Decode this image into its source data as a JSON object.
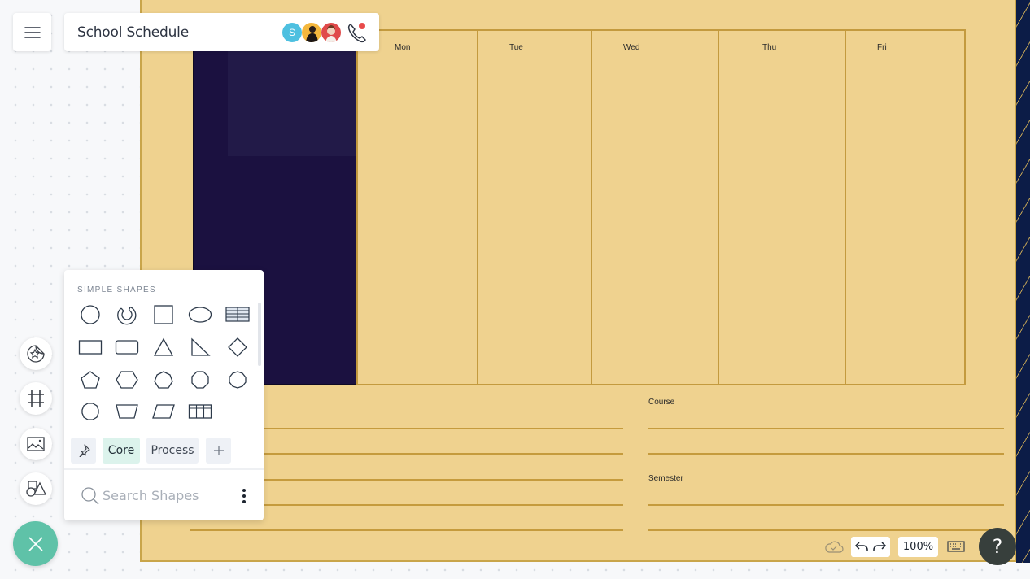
{
  "header": {
    "menu_icon": "hamburger-menu-icon",
    "title": "School Schedule",
    "collaborators": [
      {
        "initial": "S",
        "color": "#4ec0e0"
      },
      {
        "initial": "",
        "color": "#f4b73c"
      },
      {
        "initial": "",
        "color": "#e04a4a"
      }
    ],
    "call_icon": "phone-icon",
    "call_indicator_color": "#e84a4a"
  },
  "canvas": {
    "days": [
      "Mon",
      "Tue",
      "Wed",
      "Thu",
      "Fri"
    ],
    "fields": {
      "course_label": "Course",
      "semester_label": "Semester"
    },
    "colors": {
      "paper": "#efd28f",
      "line": "#c59b3d",
      "navy": "#1b1140",
      "stripe": "#0c1c47"
    }
  },
  "left_rail": {
    "buttons": [
      {
        "name": "sticker-icon"
      },
      {
        "name": "frame-icon"
      },
      {
        "name": "image-icon"
      },
      {
        "name": "shapes-icon"
      }
    ],
    "fab_icon": "close-icon",
    "fab_color": "#5fc2a8"
  },
  "shapes_panel": {
    "section_title": "SIMPLE SHAPES",
    "shapes": [
      "circle",
      "donut",
      "square",
      "ellipse",
      "table-striped",
      "rectangle",
      "rounded-rectangle",
      "triangle",
      "right-triangle",
      "diamond",
      "pentagon",
      "hexagon",
      "heptagon",
      "octagon",
      "nonagon",
      "decagon",
      "trapezoid",
      "parallelogram",
      "table-grid"
    ],
    "tabs": {
      "pin_icon": "pin-icon",
      "core": "Core",
      "process": "Process",
      "add_icon": "plus-icon"
    },
    "search": {
      "placeholder": "Search Shapes"
    },
    "more_icon": "more-vertical-icon"
  },
  "bottom_toolbar": {
    "save_status_icon": "cloud-check-icon",
    "undo_icon": "undo-icon",
    "redo_icon": "redo-icon",
    "zoom_level": "100%",
    "keyboard_icon": "keyboard-icon",
    "help_label": "?"
  }
}
